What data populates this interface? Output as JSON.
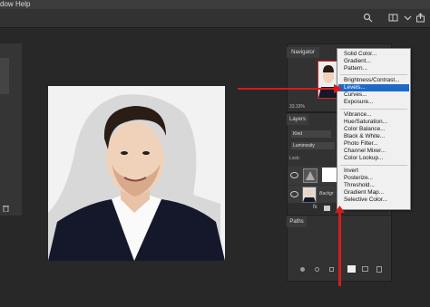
{
  "menubar": {
    "items": [
      "dow",
      "Help"
    ]
  },
  "navigator": {
    "tab_label": "Navigator",
    "zoom": "33.33%"
  },
  "layers": {
    "tab_label": "Layers",
    "kind_filter": "Kind",
    "blend_mode": "Luminosity",
    "lock_label": "Lock:",
    "background_layer_name": "Backgr"
  },
  "paths": {
    "tab_label": "Paths"
  },
  "adjustment_menu": {
    "groups": [
      [
        "Solid Color...",
        "Gradient...",
        "Pattern..."
      ],
      [
        "Brightness/Contrast...",
        "Levels...",
        "Curves...",
        "Exposure..."
      ],
      [
        "Vibrance...",
        "Hue/Saturation...",
        "Color Balance...",
        "Black & White...",
        "Photo Filter...",
        "Channel Mixer...",
        "Color Lookup..."
      ],
      [
        "Invert",
        "Posterize...",
        "Threshold...",
        "Gradient Map...",
        "Selective Color..."
      ]
    ],
    "highlighted": "Levels..."
  },
  "colors": {
    "highlight": "#1e6ac9",
    "annotation_arrow": "#d41c1c"
  }
}
